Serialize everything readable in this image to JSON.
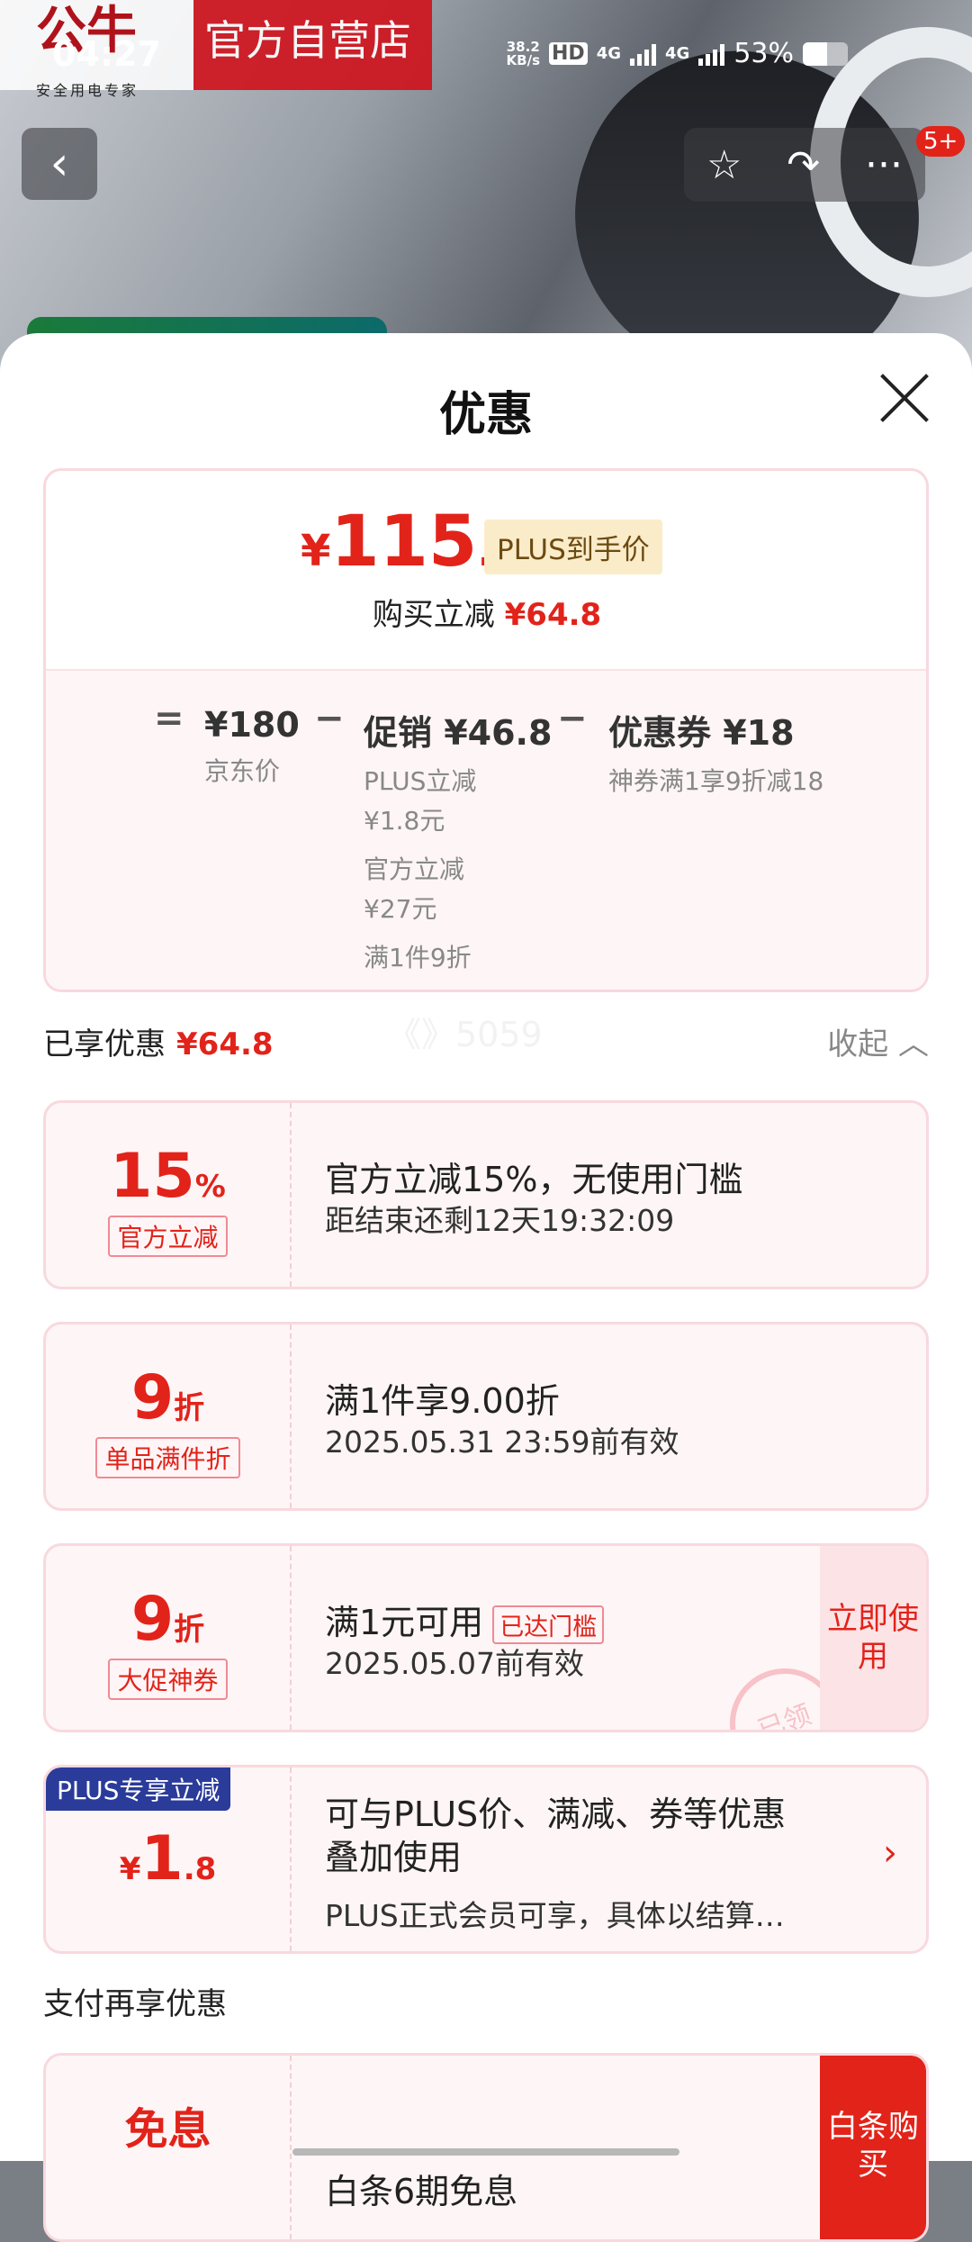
{
  "status_bar": {
    "time": "04:27",
    "net_speed": "38.2",
    "net_unit": "KB/s",
    "hd": "HD",
    "sim1": "4G",
    "sim2": "4G",
    "battery": "53%",
    "battery_level": 0.53
  },
  "brand": {
    "logo": "公牛",
    "slogan": "安全用电专家",
    "store": "官方自营店"
  },
  "nav": {
    "back": "‹",
    "star": "☆",
    "share": "↷",
    "more": "···",
    "badge": "5+"
  },
  "sheet": {
    "title": "优惠"
  },
  "price": {
    "currency": "¥",
    "int": "115",
    "dec": ".2",
    "plus_tag": "PLUS到手价",
    "buy_cut_label": "购买立减",
    "buy_cut_value": "¥64.8"
  },
  "breakdown": {
    "eq": "=",
    "minus1": "−",
    "minus2": "−",
    "jd_price": "¥180",
    "jd_label": "京东价",
    "promo_title": "促销 ¥46.8",
    "promo_plus": "PLUS立减",
    "promo_plus_amt": "¥1.8元",
    "promo_official": "官方立减",
    "promo_official_amt": "¥27元",
    "promo_full": "满1件9折",
    "coupon_title": "优惠券 ¥18",
    "coupon_desc": "神券满1享9折减18"
  },
  "saved": {
    "label": "已享优惠",
    "value": "¥64.8",
    "collapse": "收起",
    "watermark": "《》5059"
  },
  "offers": [
    {
      "num": "15",
      "unit": "%",
      "tag": "官方立减",
      "main": "官方立减15%，无使用门槛",
      "sub": "距结束还剩12天19:32:09"
    },
    {
      "num": "9",
      "unit": "折",
      "tag": "单品满件折",
      "main": "满1件享9.00折",
      "sub": "2025.05.31 23:59前有效"
    },
    {
      "num": "9",
      "unit": "折",
      "tag": "大促神券",
      "main": "满1元可用",
      "reached": "已达门槛",
      "sub": "2025.05.07前有效",
      "action": "立即使用",
      "stamp": "已领"
    },
    {
      "badge": "PLUS专享立减",
      "cur": "¥",
      "num": "1",
      "dec": ".8",
      "main1": "可与PLUS价、满减、券等优惠",
      "main2": "叠加使用",
      "sub": "PLUS正式会员可享，具体以结算…",
      "chev": "›"
    }
  ],
  "pay": {
    "label": "支付再享优惠",
    "left": "免息",
    "main": "白条6期免息",
    "action": "白条购买"
  }
}
